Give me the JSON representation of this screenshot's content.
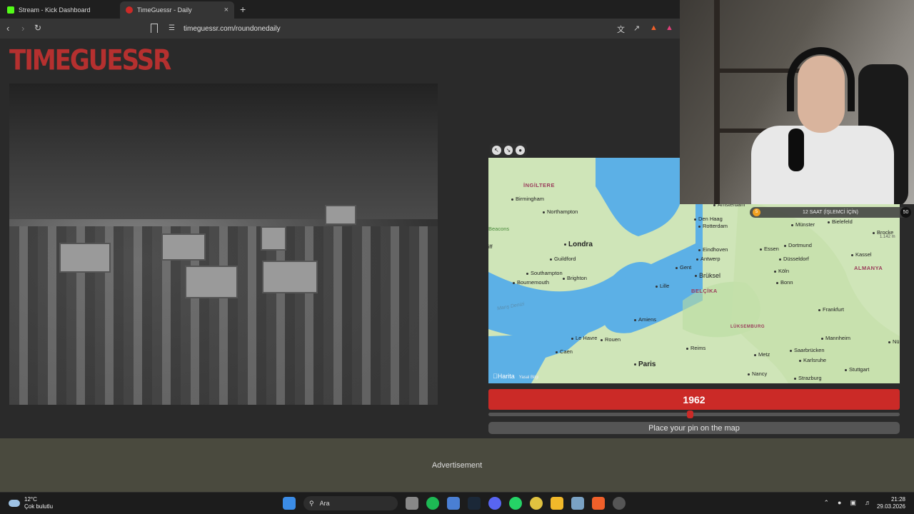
{
  "browser": {
    "tabs": [
      {
        "label": "Stream - Kick Dashboard",
        "favicon_color": "#53fc18"
      },
      {
        "label": "TimeGuessr - Daily",
        "favicon_color": "#cb2a27"
      }
    ],
    "url": "timeguessr.com/roundonedaily"
  },
  "site": {
    "logo": "TIMEGUESSR",
    "accent": "#cb2a27"
  },
  "map": {
    "countries": [
      "İNGİLTERE",
      "BELÇİKA",
      "ALMANYA",
      "LÜKSEMBURG"
    ],
    "big_cities": [
      "Londra",
      "Paris"
    ],
    "cities": [
      "Birmingham",
      "Northampton",
      "Beacons",
      "iff",
      "Guildford",
      "Southampton",
      "Brighton",
      "Bournemouth",
      "Amsterdam",
      "Den Haag",
      "Rotterdam",
      "Eindhoven",
      "Antwerp",
      "Gent",
      "Brüksel",
      "Lille",
      "Amiens",
      "Le Havre",
      "Rouen",
      "Caen",
      "Reims",
      "Essen",
      "Dortmund",
      "Münster",
      "Bielefeld",
      "Düsseldorf",
      "Köln",
      "Bonn",
      "Kassel",
      "Frankfurt",
      "Mannheim",
      "Saarbrücken",
      "Metz",
      "Karlsruhe",
      "Stuttgart",
      "Nancy",
      "Strazburg",
      "Brocke",
      "1.142 m",
      "Nü"
    ],
    "sea": "Manş Denizi",
    "attribution": "Harita",
    "legal": "Yasal Bilgi"
  },
  "game": {
    "year": "1962",
    "year_fraction": 0.5,
    "pin_prompt": "Place your pin on the map",
    "advertisement": "Advertisement"
  },
  "stream_overlay": {
    "goal_label": "12 SAAT (İŞLEMCİ İÇİN)",
    "coin": "5",
    "count": "50"
  },
  "taskbar": {
    "temperature": "12°C",
    "weather": "Çok bulutlu",
    "search": "Ara",
    "time": "21:28",
    "date": "29.03.2026"
  }
}
